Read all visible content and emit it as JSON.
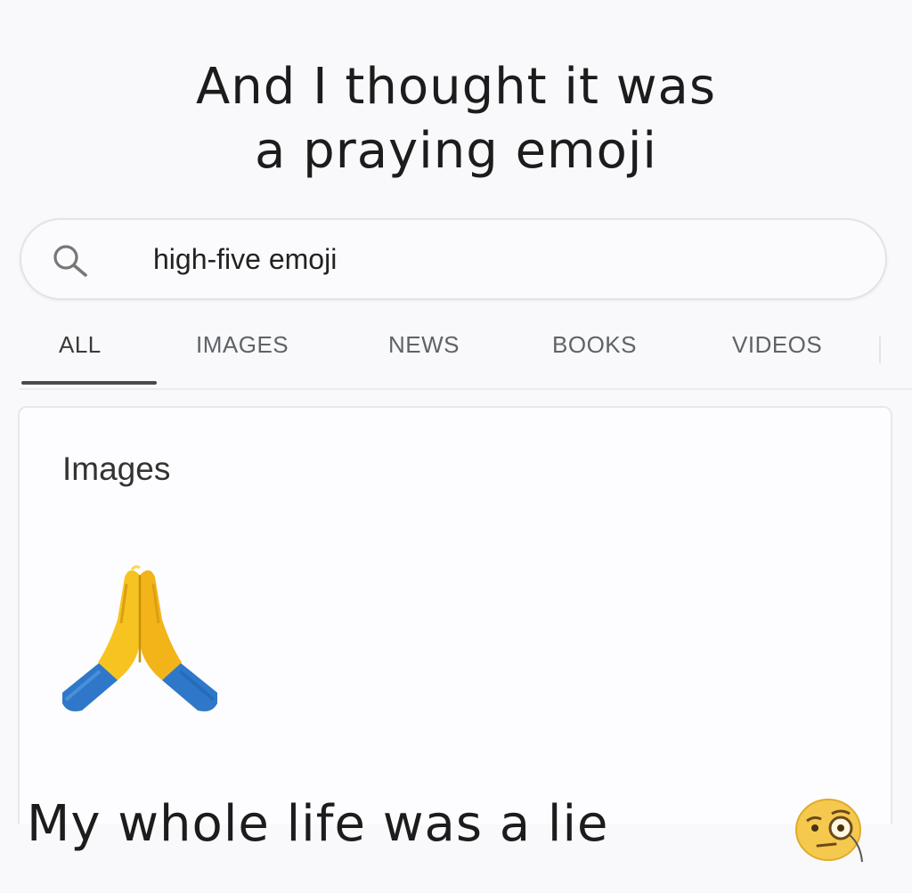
{
  "caption_top": {
    "line1": "And I thought it was",
    "line2": "a praying emoji"
  },
  "search": {
    "query": "high-five emoji",
    "icon": "search-icon"
  },
  "tabs": [
    {
      "label": "ALL",
      "active": true
    },
    {
      "label": "IMAGES",
      "active": false
    },
    {
      "label": "NEWS",
      "active": false
    },
    {
      "label": "BOOKS",
      "active": false
    },
    {
      "label": "VIDEOS",
      "active": false
    }
  ],
  "results_card": {
    "title": "Images",
    "image_icon": "folded-hands-emoji-icon"
  },
  "caption_bottom": {
    "text": "My whole life was a lie",
    "emoji_icon": "face-with-monocle-emoji-icon"
  },
  "colors": {
    "emoji_yellow": "#f7c321",
    "sleeve_blue": "#2f78c9",
    "text_dark": "#1c1c1c",
    "tab_gray": "#5f6368"
  }
}
